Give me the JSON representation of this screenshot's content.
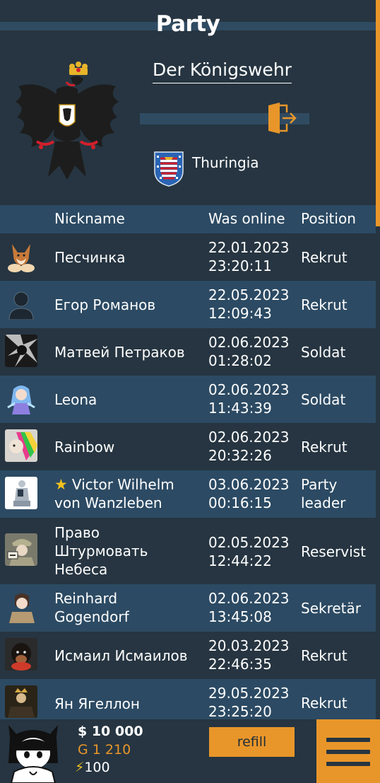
{
  "page": {
    "title": "Party"
  },
  "party": {
    "name": "Der Königswehr",
    "region": "Thuringia",
    "emblem_icon": "imperial-eagle-icon",
    "leave_icon": "exit-door-icon",
    "region_flag_icon": "thuringia-coat-of-arms-icon"
  },
  "table": {
    "headers": {
      "nickname": "Nickname",
      "online": "Was online",
      "position": "Position"
    },
    "rows": [
      {
        "nick": "Песчинка",
        "date": "22.01.2023",
        "time": "23:20:11",
        "position": "Rekrut",
        "avatar": "fox-avatar-icon"
      },
      {
        "nick": "Егор Романов",
        "date": "22.05.2023",
        "time": "12:09:43",
        "position": "Rekrut",
        "avatar": "default-person-avatar-icon"
      },
      {
        "nick": "Матвей Петраков",
        "date": "02.06.2023",
        "time": "01:28:02",
        "position": "Soldat",
        "avatar": "dark-art-avatar-icon"
      },
      {
        "nick": "Leona",
        "date": "02.06.2023",
        "time": "11:43:39",
        "position": "Soldat",
        "avatar": "anime-girl-avatar-icon"
      },
      {
        "nick": "Rainbow",
        "date": "02.06.2023",
        "time": "20:32:26",
        "position": "Rekrut",
        "avatar": "rainbow-avatar-icon"
      },
      {
        "nick": "Victor Wilhelm von Wanzleben",
        "nick_line1": "Victor Wilhelm",
        "nick_line2": "von Wanzleben",
        "date": "03.06.2023",
        "time": "00:16:15",
        "position": "Party leader",
        "position_line1": "Party",
        "position_line2": "leader",
        "avatar": "statue-avatar-icon",
        "leader_icon": "star-icon"
      },
      {
        "nick": "Право Штурмовать Небеса",
        "nick_line1": "Право",
        "nick_line2": "Штурмовать",
        "nick_line3": "Небеса",
        "date": "02.05.2023",
        "time": "12:44:22",
        "position": "Reservist",
        "avatar": "soldier-avatar-icon"
      },
      {
        "nick": "Reinhard Gogendorf",
        "nick_line1": "Reinhard",
        "nick_line2": "Gogendorf",
        "date": "02.06.2023",
        "time": "13:45:08",
        "position": "Sekretär",
        "avatar": "anime-officer-avatar-icon"
      },
      {
        "nick": "Исмаил Исмаилов",
        "date": "20.03.2023",
        "time": "22:46:35",
        "position": "Rekrut",
        "avatar": "dog-avatar-icon"
      },
      {
        "nick": "Ян Ягеллон",
        "date": "29.05.2023",
        "time": "23:25:20",
        "position": "Rekrut",
        "avatar": "king-portrait-avatar-icon"
      }
    ]
  },
  "footer": {
    "money": "$ 10 000",
    "gold": "G 1 210",
    "energy": "100",
    "energy_icon": "lightning-icon",
    "refill_label": "refill",
    "menu_icon": "hamburger-menu-icon",
    "user_avatar": "anime-girl-user-avatar-icon"
  },
  "colors": {
    "background": "#263541",
    "row_light": "#2c4a63",
    "accent": "#e8962a",
    "text": "#ffffff"
  }
}
